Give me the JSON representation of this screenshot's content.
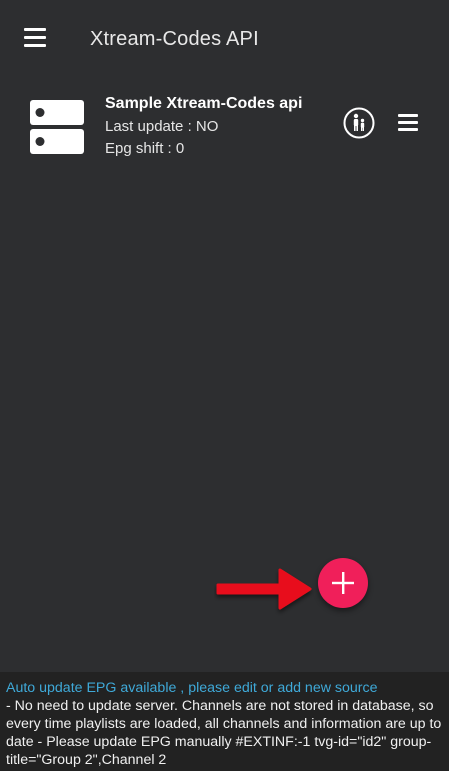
{
  "header": {
    "title": "Xtream-Codes API",
    "menu_icon": "hamburger-icon"
  },
  "sources": [
    {
      "name": "Sample Xtream-Codes api",
      "last_update": "Last update : NO",
      "epg_shift": "Epg shift : 0",
      "icon": "server-icon",
      "actions": [
        "parental-control-icon",
        "more-menu-icon"
      ]
    }
  ],
  "fab": {
    "icon": "plus-icon",
    "color": "#f01f5a"
  },
  "annotation": {
    "icon": "arrow-right-icon",
    "color": "#e8111b"
  },
  "footer": {
    "link_text": "Auto update EPG available , please edit or add new source",
    "info_text": "- No need to update server. Channels are not stored in database, so every time playlists are loaded, all channels and information are up to date - Please update EPG manually #EXTINF:-1 tvg-id=\"id2\" group-title=\"Group 2\",Channel 2"
  },
  "colors": {
    "background": "#2d2e30",
    "footer_background": "#222222",
    "link": "#3fa9d8",
    "accent": "#f01f5a"
  }
}
